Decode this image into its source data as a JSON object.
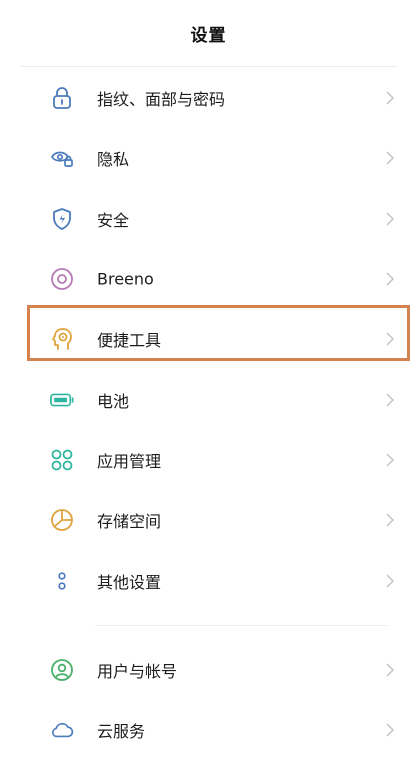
{
  "header": {
    "title": "设置"
  },
  "menu": [
    {
      "label": "指纹、面部与密码",
      "icon": "lock-icon",
      "color": "#4a7bbd"
    },
    {
      "label": "隐私",
      "icon": "privacy-eye-icon",
      "color": "#4a7bbd"
    },
    {
      "label": "安全",
      "icon": "shield-icon",
      "color": "#4a7bbd"
    },
    {
      "label": "Breeno",
      "icon": "breeno-icon",
      "color": "#b67ab6"
    },
    {
      "label": "便捷工具",
      "icon": "head-tool-icon",
      "color": "#e0a23c"
    },
    {
      "label": "电池",
      "icon": "battery-icon",
      "color": "#2fb6a0"
    },
    {
      "label": "应用管理",
      "icon": "apps-grid-icon",
      "color": "#2fb6a0"
    },
    {
      "label": "存储空间",
      "icon": "storage-pie-icon",
      "color": "#e0a23c"
    },
    {
      "label": "其他设置",
      "icon": "more-dots-icon",
      "color": "#4a7bbd"
    }
  ],
  "menu2": [
    {
      "label": "用户与帐号",
      "icon": "user-account-icon",
      "color": "#4bb06a"
    },
    {
      "label": "云服务",
      "icon": "cloud-icon",
      "color": "#4a7bbd"
    }
  ],
  "highlight_color": "#d6824e"
}
